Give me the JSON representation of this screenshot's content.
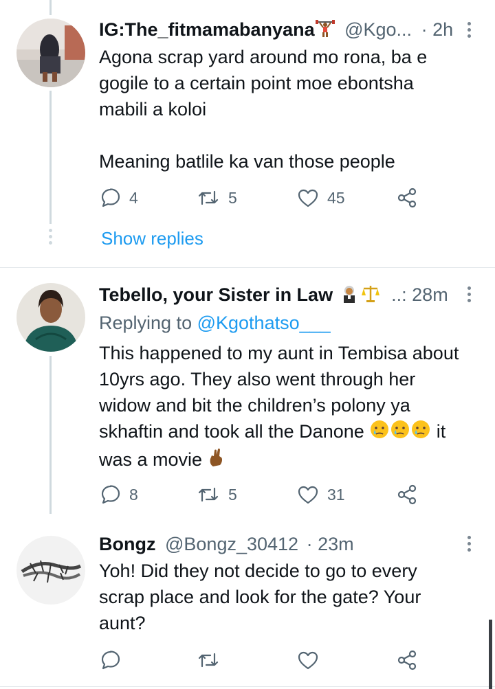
{
  "tweets": [
    {
      "display_name": "IG:The_fitmamabanyana",
      "handle": "@Kgo...",
      "time_sep": "·",
      "time": "2h",
      "text_lines": [
        "Agona scrap yard around mo rona, ba e",
        "gogile to a certain point moe ebontsha",
        "mabili a koloi",
        "",
        "Meaning batlile ka van those people"
      ],
      "replies": "4",
      "retweets": "5",
      "likes": "45",
      "show_replies": "Show replies"
    },
    {
      "display_name": "Tebello, your Sister in Law",
      "handle": "..",
      "time_sep": ":",
      "time": "28m",
      "replying_prefix": "Replying to",
      "replying_handle": "@Kgothatso___",
      "text_lines": [
        "This happened to my aunt in Tembisa about",
        "10yrs ago. They also went through her",
        "widow and bit the children’s polony ya",
        "skhaftin and took all the Danone",
        "was a movie"
      ],
      "text_tail": "it",
      "replies": "8",
      "retweets": "5",
      "likes": "31"
    },
    {
      "display_name": "Bongz",
      "handle": "@Bongz_30412",
      "time_sep": "·",
      "time": "23m",
      "text_lines": [
        "Yoh! Did they not decide to go to every",
        "scrap place and look for the gate? Your",
        "aunt?"
      ]
    }
  ],
  "icons": {
    "reply": "speech-bubble-icon",
    "retweet": "retweet-icon",
    "like": "heart-icon",
    "share": "share-icon",
    "more": "more-vertical-icon",
    "emoji_weightlifter": "woman-lifting-weights-icon",
    "emoji_judge": "judge-icon",
    "emoji_scales": "scales-icon",
    "emoji_crying": "crying-face-icon",
    "emoji_fingers": "crossed-fingers-icon"
  },
  "colors": {
    "link": "#1d9bf0",
    "text": "#0f1419",
    "muted": "#536471",
    "thread": "#cfd9de"
  }
}
